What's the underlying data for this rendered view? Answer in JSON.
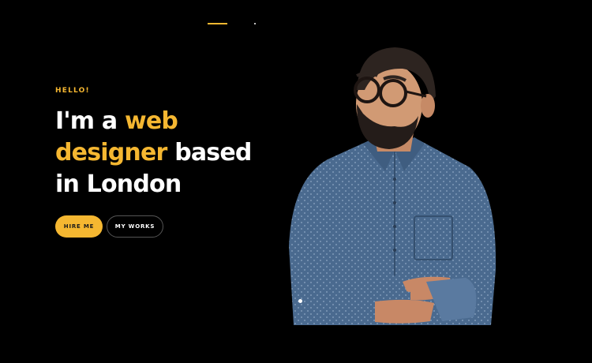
{
  "hero": {
    "greeting": "HELLO!",
    "headline": {
      "part1": "I'm a ",
      "accent1": "web",
      "accent2": "designer",
      "part2": " based",
      "part3": "in London"
    },
    "buttons": {
      "primary": "HIRE ME",
      "secondary": "MY WORKS"
    }
  },
  "colors": {
    "background": "#000000",
    "accent": "#f5b731",
    "text": "#ffffff",
    "shirt": "#4a6a8f"
  },
  "image": {
    "subject": "man-with-glasses-arms-crossed"
  }
}
